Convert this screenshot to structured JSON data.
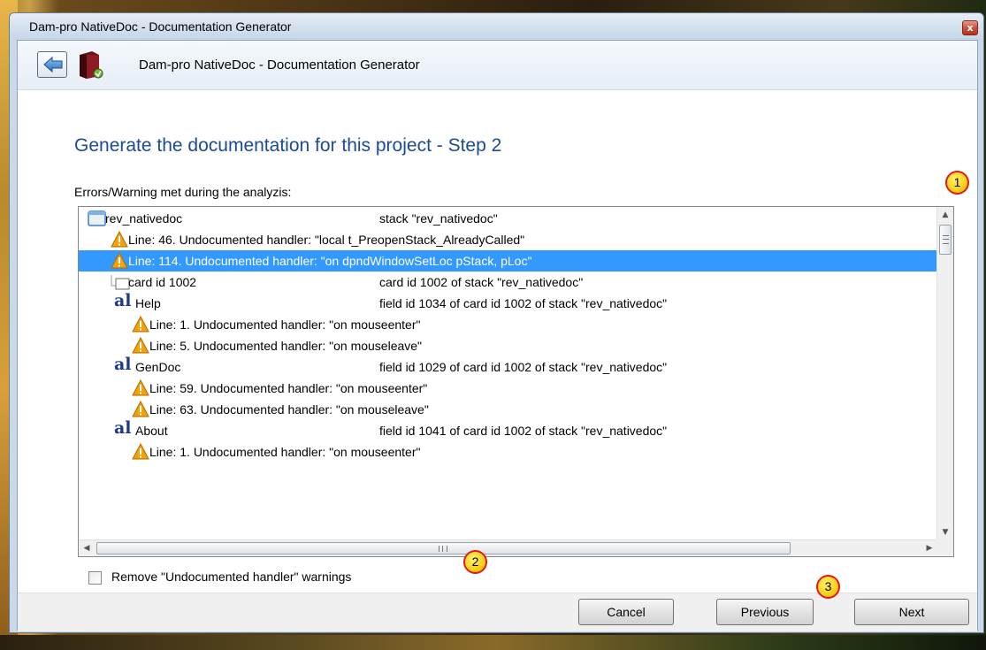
{
  "window": {
    "title": "Dam-pro NativeDoc - Documentation Generator",
    "close_glyph": "x"
  },
  "header": {
    "title": "Dam-pro NativeDoc - Documentation Generator"
  },
  "main": {
    "heading": "Generate the documentation for this project - Step 2",
    "list_label": "Errors/Warning met during the analyzis:"
  },
  "tree": {
    "rows": [
      {
        "type": "stack",
        "name": "rev_nativedoc",
        "desc": "stack \"rev_nativedoc\"",
        "indent": 0,
        "selected": false
      },
      {
        "type": "warning",
        "name": "Line: 46. Undocumented handler: \"local t_PreopenStack_AlreadyCalled\"",
        "desc": "",
        "indent": 1,
        "selected": false
      },
      {
        "type": "warning",
        "name": "Line: 114. Undocumented handler: \"on dpndWindowSetLoc pStack, pLoc\"",
        "desc": "",
        "indent": 1,
        "selected": true
      },
      {
        "type": "card",
        "name": "card id 1002",
        "desc": "card id 1002 of stack \"rev_nativedoc\"",
        "indent": 1,
        "selected": false
      },
      {
        "type": "field",
        "name": "Help",
        "desc": "field id 1034 of card id 1002 of stack \"rev_nativedoc\"",
        "indent": 2,
        "selected": false
      },
      {
        "type": "warning",
        "name": "Line: 1. Undocumented handler: \"on mouseenter\"",
        "desc": "",
        "indent": 3,
        "selected": false
      },
      {
        "type": "warning",
        "name": "Line: 5. Undocumented handler: \"on mouseleave\"",
        "desc": "",
        "indent": 3,
        "selected": false
      },
      {
        "type": "field",
        "name": "GenDoc",
        "desc": "field id 1029 of card id 1002 of stack \"rev_nativedoc\"",
        "indent": 2,
        "selected": false
      },
      {
        "type": "warning",
        "name": "Line: 59. Undocumented handler: \"on mouseenter\"",
        "desc": "",
        "indent": 3,
        "selected": false
      },
      {
        "type": "warning",
        "name": "Line: 63. Undocumented handler: \"on mouseleave\"",
        "desc": "",
        "indent": 3,
        "selected": false
      },
      {
        "type": "field",
        "name": "About",
        "desc": "field id 1041 of card id 1002 of stack \"rev_nativedoc\"",
        "indent": 2,
        "selected": false
      },
      {
        "type": "warning",
        "name": "Line: 1. Undocumented handler: \"on mouseenter\"",
        "desc": "",
        "indent": 3,
        "selected": false
      }
    ],
    "icons": {
      "stack": "stack-window-icon",
      "warning": "warning-triangle-icon",
      "card": "card-icon",
      "field": "text-field-icon"
    },
    "field_icon_glyph": "al"
  },
  "options": {
    "remove_warnings_label": "Remove \"Undocumented handler\" warnings",
    "remove_warnings_checked": false
  },
  "buttons": {
    "cancel": "Cancel",
    "previous": "Previous",
    "next": "Next"
  },
  "markers": [
    "1",
    "2",
    "3"
  ],
  "colors": {
    "heading": "#1c4a94",
    "selection": "#3399ff",
    "marker_fill": "#f6cf1a",
    "marker_border": "#e31a1a",
    "warning": "#f0a30a"
  }
}
